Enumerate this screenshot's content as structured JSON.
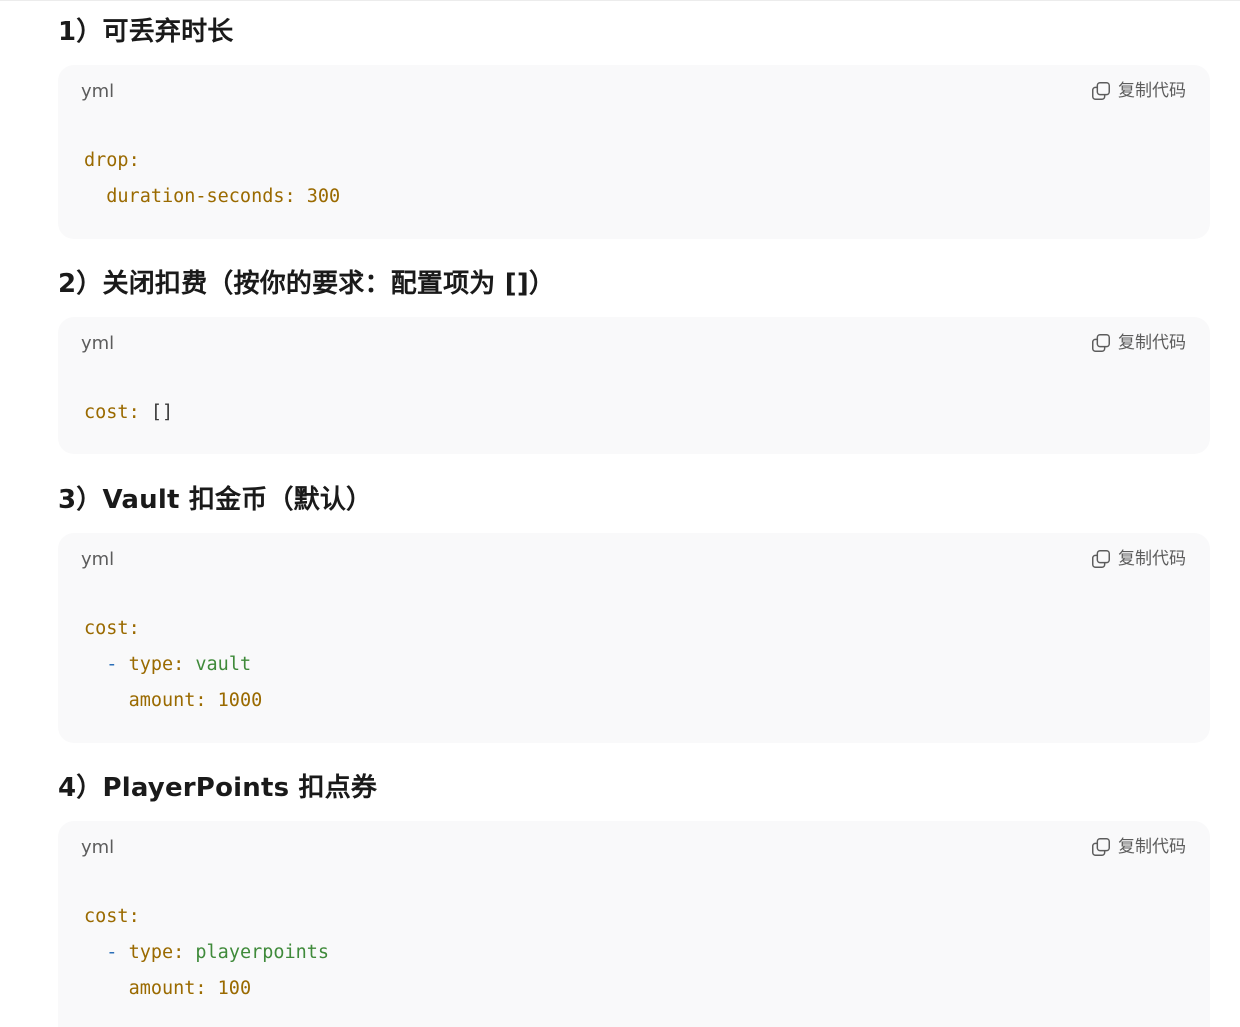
{
  "sections": [
    {
      "title": "1）可丢弃时长",
      "lang": "yml",
      "copy_label": "复制代码",
      "code": {
        "l1_key": "drop",
        "l1_colon": ":",
        "l2_indent": "  ",
        "l2_key": "duration-seconds",
        "l2_colon": ": ",
        "l2_value": "300"
      }
    },
    {
      "title": "2）关闭扣费（按你的要求：配置项为 []）",
      "lang": "yml",
      "copy_label": "复制代码",
      "code": {
        "l1_key": "cost",
        "l1_colon": ": ",
        "l1_value": "[]"
      }
    },
    {
      "title": "3）Vault 扣金币（默认）",
      "lang": "yml",
      "copy_label": "复制代码",
      "code": {
        "l1_key": "cost",
        "l1_colon": ":",
        "l2_indent": "  ",
        "l2_dash": "- ",
        "l2_key": "type",
        "l2_colon": ": ",
        "l2_value": "vault",
        "l3_indent": "    ",
        "l3_key": "amount",
        "l3_colon": ": ",
        "l3_value": "1000"
      }
    },
    {
      "title": "4）PlayerPoints 扣点券",
      "lang": "yml",
      "copy_label": "复制代码",
      "code": {
        "l1_key": "cost",
        "l1_colon": ":",
        "l2_indent": "  ",
        "l2_dash": "- ",
        "l2_key": "type",
        "l2_colon": ": ",
        "l2_value": "playerpoints",
        "l3_indent": "    ",
        "l3_key": "amount",
        "l3_colon": ": ",
        "l3_value": "100"
      }
    }
  ],
  "icons": {
    "copy": "copy-icon"
  },
  "colors": {
    "key": "#9a6a00",
    "string": "#3f8a3a",
    "dash": "#2b6fb8",
    "block_bg": "#f9f9fa"
  }
}
